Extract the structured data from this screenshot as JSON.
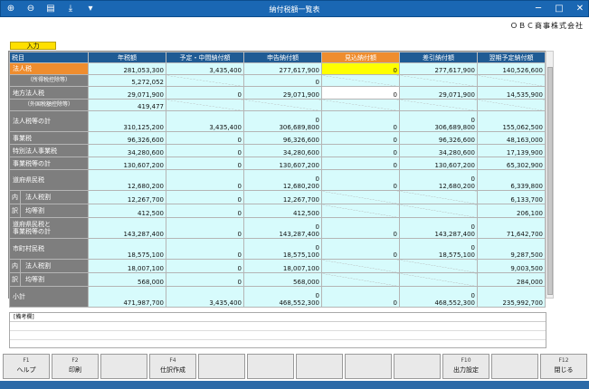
{
  "window": {
    "title": "納付税額一覧表",
    "company": "ＯＢＣ商事株式会社"
  },
  "toolbar_icons": [
    "zoom-in-icon",
    "zoom-out-icon",
    "print-icon",
    "pdf-icon",
    "dropdown-icon"
  ],
  "tab_label": "入力",
  "columns": [
    "税目",
    "年税額",
    "予定・中間納付額",
    "申告納付額",
    "見込納付額",
    "差引納付額",
    "翌期予定納付額"
  ],
  "rows": [
    {
      "label": "法人税",
      "selected": true,
      "v": [
        "281,053,300",
        "3,435,400",
        "277,617,900",
        "0",
        "277,617,900",
        "140,526,600"
      ]
    },
    {
      "label": "（所得税控除等）",
      "sub": true,
      "v": [
        "5,272,052",
        "",
        "0",
        "",
        "",
        ""
      ]
    },
    {
      "label": "地方法人税",
      "v": [
        "29,071,900",
        "0",
        "29,071,900",
        "0",
        "29,071,900",
        "14,535,900"
      ]
    },
    {
      "label": "（外国税額控除等）",
      "sub": true,
      "v": [
        "419,477",
        "",
        "",
        "",
        "",
        ""
      ]
    },
    {
      "label": "法人税等の計",
      "tall": true,
      "v": [
        "310,125,200",
        "3,435,400",
        "0|306,689,800",
        "0",
        "0|306,689,800",
        "155,062,500"
      ]
    },
    {
      "label": "事業税",
      "v": [
        "96,326,600",
        "0",
        "96,326,600",
        "0",
        "96,326,600",
        "48,163,000"
      ]
    },
    {
      "label": "特別法人事業税",
      "v": [
        "34,280,600",
        "0",
        "34,280,600",
        "0",
        "34,280,600",
        "17,139,900"
      ]
    },
    {
      "label": "事業税等の計",
      "v": [
        "130,607,200",
        "0",
        "130,607,200",
        "0",
        "130,607,200",
        "65,302,900"
      ]
    },
    {
      "label": "道府県民税",
      "tall": true,
      "v": [
        "12,680,200",
        "0",
        "0|12,680,200",
        "0",
        "0|12,680,200",
        "6,339,800"
      ]
    },
    {
      "label": "法人税割",
      "prefix": "内",
      "v": [
        "12,267,700",
        "0",
        "12,267,700",
        "",
        "",
        "6,133,700"
      ]
    },
    {
      "label": "均等割",
      "prefix": "訳",
      "v": [
        "412,500",
        "0",
        "412,500",
        "",
        "",
        "206,100"
      ]
    },
    {
      "label": "道府県民税と|事業税等の計",
      "tall": true,
      "v": [
        "143,287,400",
        "0",
        "0|143,287,400",
        "0",
        "0|143,287,400",
        "71,642,700"
      ]
    },
    {
      "label": "市町村民税",
      "tall": true,
      "v": [
        "18,575,100",
        "0",
        "0|18,575,100",
        "0",
        "0|18,575,100",
        "9,287,500"
      ]
    },
    {
      "label": "法人税割",
      "prefix": "内",
      "v": [
        "18,007,100",
        "0",
        "18,007,100",
        "",
        "",
        "9,003,500"
      ]
    },
    {
      "label": "均等割",
      "prefix": "訳",
      "v": [
        "568,000",
        "0",
        "568,000",
        "",
        "",
        "284,000"
      ]
    },
    {
      "label": "小計",
      "tall": true,
      "v": [
        "471,987,700",
        "3,435,400",
        "0|468,552,300",
        "0",
        "0|468,552,300",
        "235,992,700"
      ]
    }
  ],
  "memo_label": "[備考欄]",
  "fkeys": [
    {
      "num": "F1",
      "label": "ヘルプ"
    },
    {
      "num": "F2",
      "label": "印刷"
    },
    {
      "num": "",
      "label": ""
    },
    {
      "num": "F4",
      "label": "仕訳作成"
    },
    {
      "num": "",
      "label": ""
    },
    {
      "num": "",
      "label": ""
    },
    {
      "num": "",
      "label": ""
    },
    {
      "num": "",
      "label": ""
    },
    {
      "num": "",
      "label": ""
    },
    {
      "num": "F10",
      "label": "出力設定"
    },
    {
      "num": "",
      "label": ""
    },
    {
      "num": "F12",
      "label": "閉じる"
    }
  ],
  "colors": {
    "header": "#1f5b94",
    "selected": "#ef8d2e",
    "cell": "#d7fbfc",
    "input_yellow": "#ffff00",
    "titlebar": "#1a67b3"
  }
}
